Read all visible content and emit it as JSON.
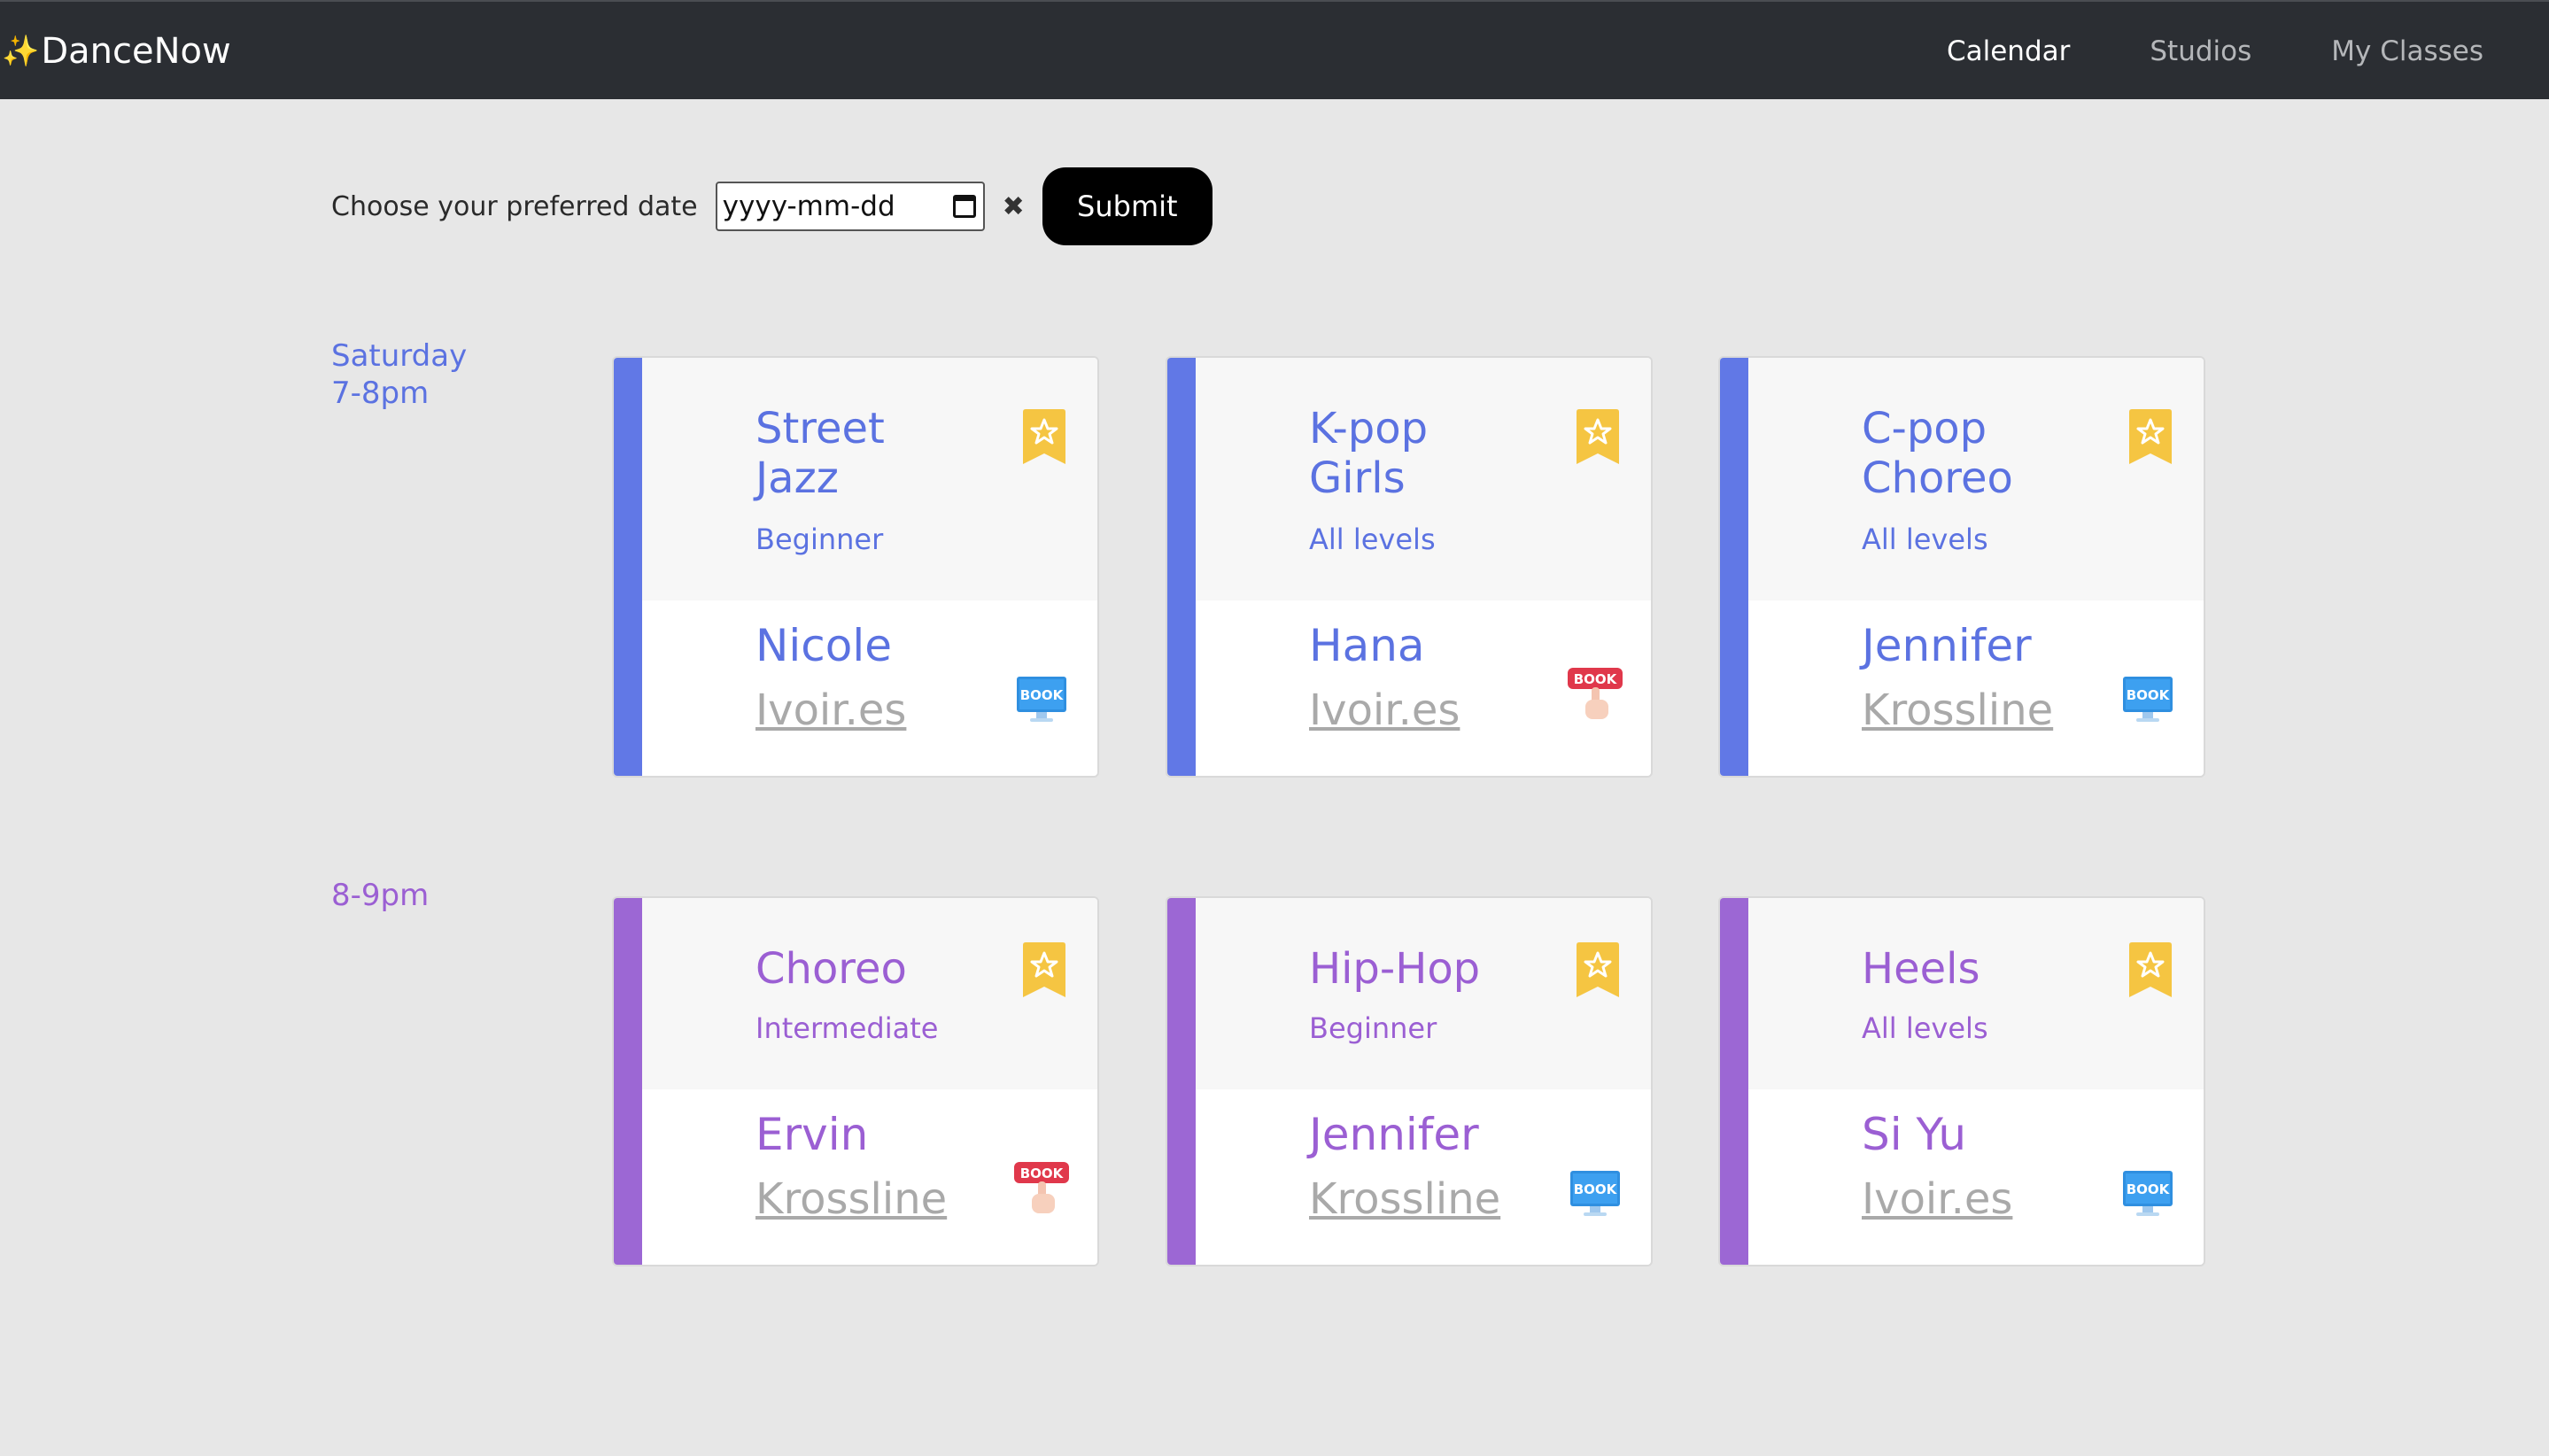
{
  "nav": {
    "brand_icon": "✨",
    "brand": "DanceNow",
    "links": [
      {
        "label": "Calendar",
        "active": true
      },
      {
        "label": "Studios",
        "active": false
      },
      {
        "label": "My Classes",
        "active": false
      }
    ]
  },
  "date_filter": {
    "label": "Choose your preferred date",
    "placeholder": "yyyy-mm-dd",
    "clear_icon": "✖",
    "submit_label": "Submit"
  },
  "colors": {
    "blue": "#6178e6",
    "purple": "#9c67d4",
    "favorite": "#f5c542",
    "navbar": "#2b2e33"
  },
  "slots": [
    {
      "day": "Saturday",
      "time": "7-8pm",
      "classes": [
        {
          "title_line1": "Street",
          "title_line2": "Jazz",
          "level": "Beginner",
          "teacher": "Nicole",
          "studio": "Ivoir.es",
          "book_icon": "book-monitor-icon"
        },
        {
          "title_line1": "K-pop",
          "title_line2": "Girls",
          "level": "All levels",
          "teacher": "Hana",
          "studio": "Ivoir.es",
          "book_icon": "book-hand-icon"
        },
        {
          "title_line1": "C-pop",
          "title_line2": "Choreo",
          "level": "All levels",
          "teacher": "Jennifer",
          "studio": "Krossline",
          "book_icon": "book-monitor-icon"
        }
      ]
    },
    {
      "day": "",
      "time": "8-9pm",
      "classes": [
        {
          "title_line1": "Choreo",
          "level": "Intermediate",
          "teacher": "Ervin",
          "studio": "Krossline",
          "book_icon": "book-hand-icon"
        },
        {
          "title_line1": "Hip-Hop",
          "level": "Beginner",
          "teacher": "Jennifer",
          "studio": "Krossline",
          "book_icon": "book-monitor-icon"
        },
        {
          "title_line1": "Heels",
          "level": "All levels",
          "teacher": "Si Yu",
          "studio": "Ivoir.es",
          "book_icon": "book-monitor-icon"
        }
      ]
    }
  ],
  "book_badge_text": "BOOK"
}
